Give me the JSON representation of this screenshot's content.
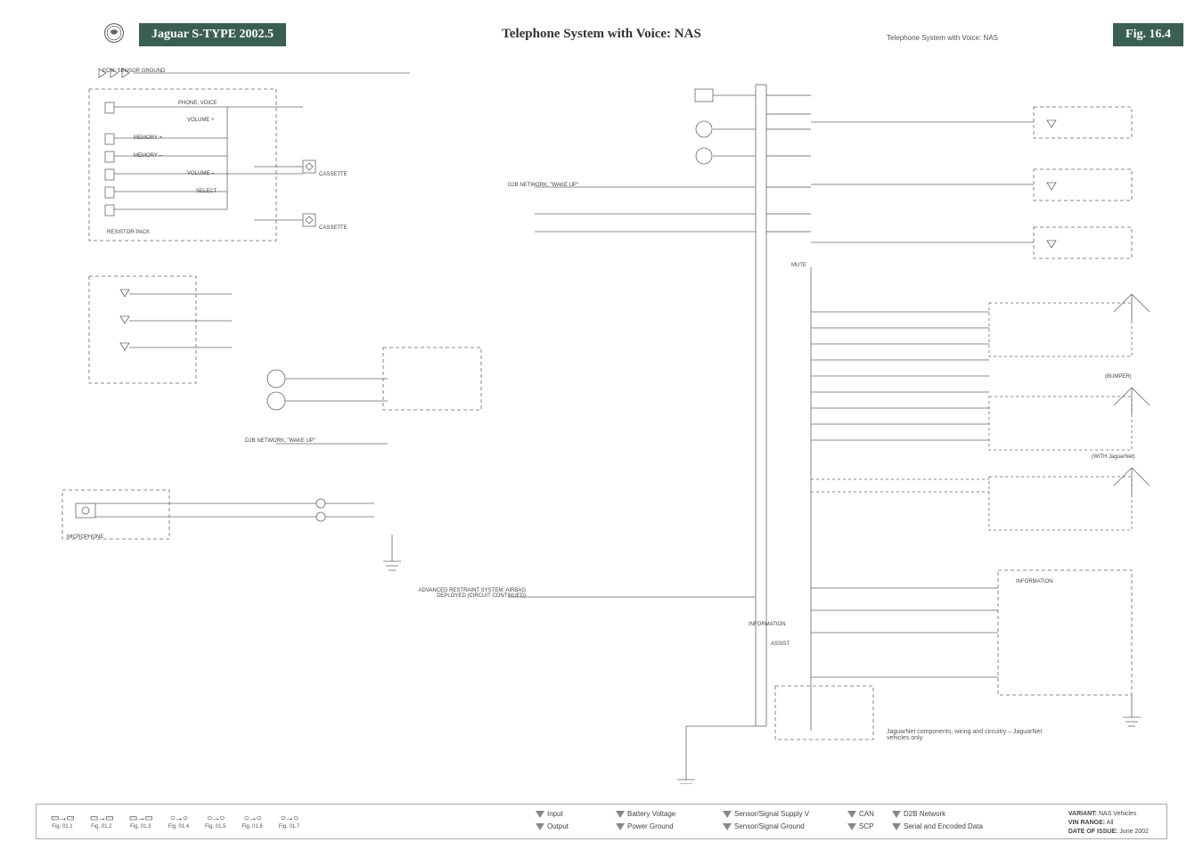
{
  "header": {
    "model": "Jaguar S-TYPE 2002.5",
    "title": "Telephone System with Voice: NAS",
    "subtitle": "Telephone System with Voice: NAS",
    "fig": "Fig. 16.4"
  },
  "labels": {
    "ecm": "ECM: SENSOR GROUND",
    "phone_voice": "PHONE, VOICE",
    "volume_plus": "VOLUME +",
    "memory_plus": "MEMORY +",
    "memory_minus": "MEMORY –",
    "volume_minus": "VOLUME –",
    "select": "SELECT",
    "resistor_pack": "RESISTOR PACK",
    "cassette1": "CASSETTE",
    "cassette2": "CASSETTE",
    "d2b_wakeup1": "D2B NETWORK; \"WAKE UP\"",
    "d2b_wakeup2": "D2B NETWORK; \"WAKE UP\"",
    "microphone": "MICROPHONE",
    "advanced_restraint": "ADVANCED RESTRAINT SYSTEM: AIRBAG DEPLOYED (CIRCUIT CONTINUED)",
    "mute": "MUTE",
    "information": "INFORMATION",
    "information2": "INFORMATION",
    "assist": "ASSIST",
    "bumper": "(BUMPER)",
    "with_jaguarnet": "(WITH JaguarNet)",
    "jaguarnet_note": "JaguarNet components, wiring and circuitry – JaguarNet vehicles only."
  },
  "legend": {
    "input": "Input",
    "output": "Output",
    "battery": "Battery Voltage",
    "power_ground": "Power Ground",
    "sensor_supply": "Sensor/Signal Supply V",
    "sensor_ground": "Sensor/Signal Ground",
    "can": "CAN",
    "scp": "SCP",
    "d2b": "D2B Network",
    "serial": "Serial and Encoded Data"
  },
  "fig_refs": [
    "Fig. 01.1",
    "Fig. 01.2",
    "Fig. 01.3",
    "Fig. 01.4",
    "Fig. 01.5",
    "Fig. 01.6",
    "Fig. 01.7"
  ],
  "meta": {
    "variant_label": "VARIANT:",
    "variant": "NAS Vehicles",
    "vin_label": "VIN RANGE:",
    "vin": "All",
    "date_label": "DATE OF ISSUE:",
    "date": "June 2002"
  }
}
